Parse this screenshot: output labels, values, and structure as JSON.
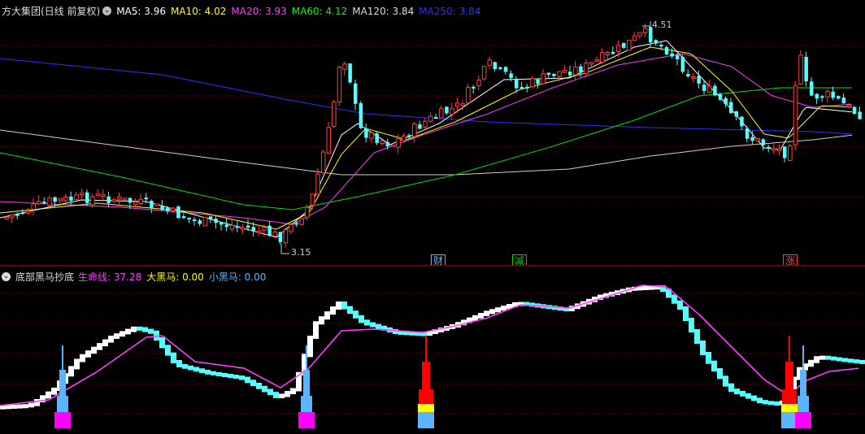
{
  "upper": {
    "title": "方大集团(日线 前复权)",
    "ma": [
      {
        "label": "MA5: 3.96",
        "color": "#ffffff"
      },
      {
        "label": "MA10: 4.02",
        "color": "#ffff00"
      },
      {
        "label": "MA20: 3.93",
        "color": "#ff3cff"
      },
      {
        "label": "MA60: 4.12",
        "color": "#00ff00"
      },
      {
        "label": "MA120: 3.84",
        "color": "#dddddd"
      },
      {
        "label": "MA250: 3.84",
        "color": "#3030ff"
      }
    ],
    "high_label": "4.51",
    "low_label": "3.15",
    "events": [
      {
        "text": "财",
        "color": "#5ab4ff"
      },
      {
        "text": "减",
        "color": "#00d200"
      },
      {
        "text": "涨",
        "color": "#ff4040"
      }
    ]
  },
  "lower": {
    "title": "底部黑马抄底",
    "values": [
      {
        "label": "生命线: 37.28",
        "color": "#ff3cff"
      },
      {
        "label": "大黑马: 0.00",
        "color": "#ffff00"
      },
      {
        "label": "小黑马: 0.00",
        "color": "#5ab4ff"
      }
    ]
  },
  "colors": {
    "up": "#ff4040",
    "down": "#54ffff",
    "grid": "#8a0000",
    "life_line": "#ff3cff",
    "spike_red": "#ff0000",
    "spike_magenta": "#ff00ff",
    "spike_blue": "#5ab4ff",
    "spike_yellow": "#ffff00"
  }
}
